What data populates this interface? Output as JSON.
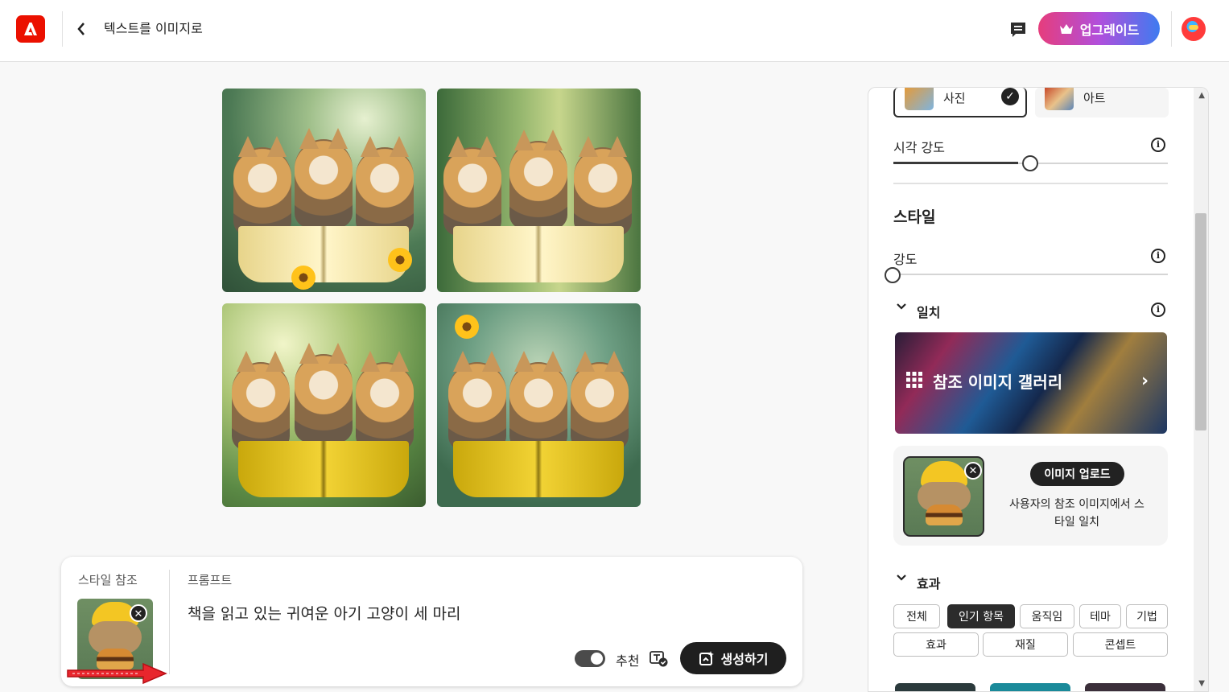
{
  "header": {
    "title": "텍스트를 이미지로",
    "upgrade_label": "업그레이드",
    "brand_color": "#eb1000"
  },
  "results": {
    "images": [
      {
        "alt": "kittens-reading-1",
        "book": "white"
      },
      {
        "alt": "kittens-reading-2",
        "book": "white"
      },
      {
        "alt": "kittens-reading-3",
        "book": "yellow"
      },
      {
        "alt": "kittens-reading-4",
        "book": "yellow"
      }
    ]
  },
  "prompt_card": {
    "style_ref_label": "스타일 참조",
    "prompt_label": "프롬프트",
    "prompt_text": "책을 읽고 있는 귀여운 아기 고양이 세 마리",
    "suggest_label": "추천",
    "suggest_on": true,
    "generate_label": "생성하기"
  },
  "panel": {
    "content_types": [
      {
        "label": "사진",
        "selected": true
      },
      {
        "label": "아트",
        "selected": false
      }
    ],
    "visual_intensity": {
      "label": "시각 강도",
      "value_fraction": 0.5
    },
    "style_heading": "스타일",
    "strength": {
      "label": "강도",
      "value_fraction": 0.0
    },
    "match": {
      "label": "일치",
      "gallery_label": "참조 이미지 갤러리",
      "upload_button": "이미지 업로드",
      "upload_desc": "사용자의 참조 이미지에서 스타일 일치"
    },
    "effects": {
      "label": "효과",
      "chips_row1": [
        "전체",
        "인기 항목",
        "움직임",
        "테마",
        "기법"
      ],
      "chips_row2": [
        "효과",
        "재질",
        "콘셉트"
      ],
      "selected": "인기 항목"
    }
  }
}
